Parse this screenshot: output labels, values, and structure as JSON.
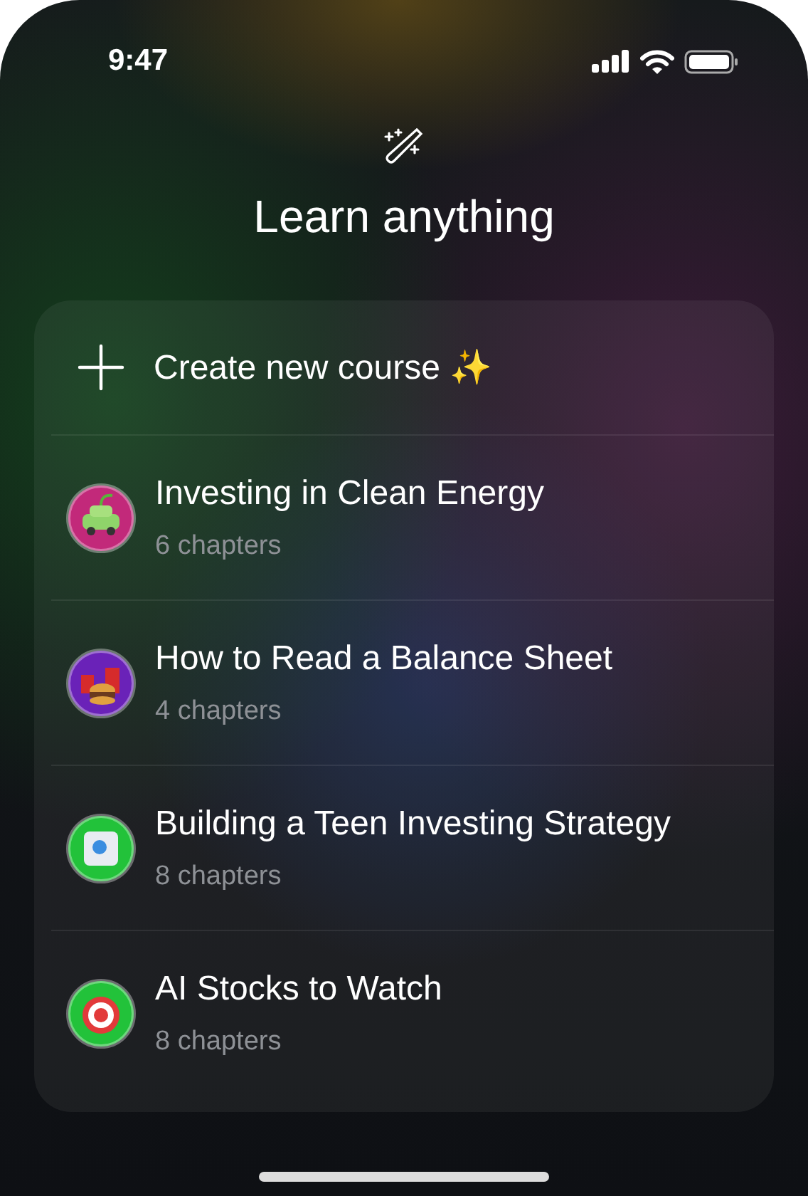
{
  "status_bar": {
    "time": "9:47"
  },
  "header": {
    "title": "Learn anything"
  },
  "create": {
    "label": "Create new course ✨"
  },
  "courses": [
    {
      "title": "Investing in Clean Energy",
      "chapters": "6 chapters",
      "kind": "car",
      "color": "#c2297a"
    },
    {
      "title": "How to Read a Balance Sheet",
      "chapters": "4 chapters",
      "kind": "food",
      "color": "#6a22b8"
    },
    {
      "title": "Building a Teen Investing Strategy",
      "chapters": "8 chapters",
      "kind": "safe",
      "color": "#22c23a"
    },
    {
      "title": "AI Stocks to Watch",
      "chapters": "8 chapters",
      "kind": "target",
      "color": "#22c23a"
    }
  ]
}
